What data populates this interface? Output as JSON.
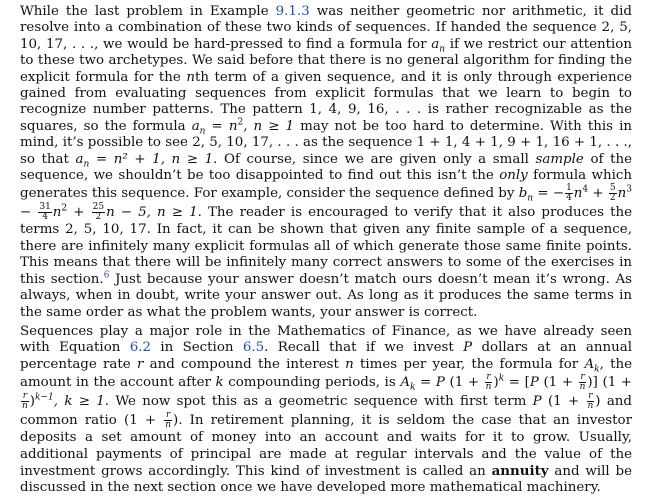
{
  "paragraph1": {
    "s01": "While the last problem in Example ",
    "ref_example": "9.1.3",
    "s02": " was neither geometric nor arithmetic, it did resolve into a combination of these two kinds of sequences. If handed the sequence 2, 5, 10, 17, . . ., we would be hard-pressed to find a formula for ",
    "s03": " if we restrict our attention to these two archetypes. We said before that there is no general algorithm for finding the explicit formula for the ",
    "s04": "th term of a given sequence, and it is only through experience gained from evaluating sequences from explicit formulas that we learn to begin to recognize number patterns. The pattern 1, 4, 9, 16, . . . is rather recognizable as the squares, so the formula ",
    "s05": " may not be too hard to determine. With this in mind, it’s possible to see 2, 5, 10, 17, . . . as the sequence 1 + 1, 4 + 1, 9 + 1, 16 + 1, . . ., so that ",
    "s06": ". Of course, since we are given only a small ",
    "s07": "sample",
    "s08": " of the sequence, we shouldn’t be too disappointed to find out this isn’t the ",
    "s09": "only",
    "s10": " formula which generates this sequence. For example, consider the sequence defined by ",
    "s11": ". The reader is encouraged to verify that it also produces the terms 2, 5, 10, 17. In fact, it can be shown that given any finite sample of a sequence, there are infinitely many explicit formulas all of which generate those same finite points. This means that there will be infinitely many correct answers to some of the exercises in this section.",
    "footnote_mark": "6",
    "s12": " Just because your answer doesn’t match ours doesn’t mean it’s wrong. As always, when in doubt, write your answer out. As long as it produces the same terms in the same order as what the problem wants, your answer is correct."
  },
  "paragraph2": {
    "s01": "Sequences play a major role in the Mathematics of Finance, as we have already seen with Equation ",
    "ref_equation": "6.2",
    "s02": " in Section ",
    "ref_section": "6.5",
    "s03": ". Recall that if we invest ",
    "s04": " dollars at an annual percentage rate ",
    "s05": " and compound the interest ",
    "s06": " times per year, the formula for ",
    "s07": ", the amount in the account after ",
    "s08": " compounding periods, is ",
    "s09": ". We now spot this as a geometric sequence with first term ",
    "s10": " and common ratio ",
    "s11": ". In retirement planning, it is seldom the case that an investor deposits a set amount of money into an account and waits for it to grow. Usually, additional payments of principal are made at regular intervals and the value of the investment grows accordingly. This kind of investment is called an ",
    "term_annuity": "annuity",
    "s12": " and will be discussed in the next section once we have developed more mathematical machinery."
  },
  "math": {
    "a": "a",
    "n": "n",
    "P": "P",
    "r": "r",
    "A": "A",
    "k": "k",
    "b": "b",
    "eq": " = ",
    "minus": " − ",
    "plus": " + ",
    "comma_n_geq_1": ", n ≥ 1",
    "comma_k_geq_1": ", k ≥ 1",
    "two": "2",
    "four": "4",
    "three": "3",
    "one": "1",
    "five": "5",
    "thirtyone": "31",
    "twentyfive": "25",
    "n_squared_plus_1": "n² + 1",
    "open_1_plus": "(1 + ",
    "close_paren": ")",
    "bracket_open": "[",
    "bracket_close": "]",
    "k_minus_1": "k−1",
    "minus_5": "n − 5"
  }
}
